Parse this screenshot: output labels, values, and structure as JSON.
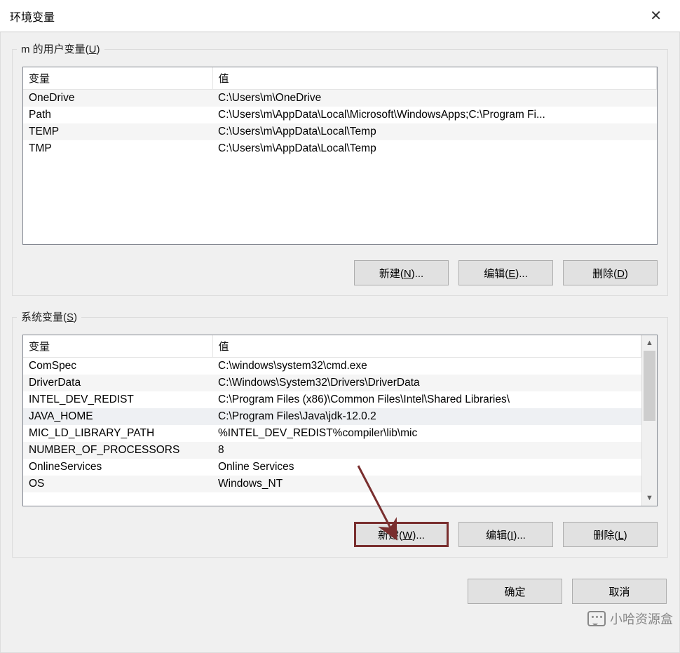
{
  "window": {
    "title": "环境变量"
  },
  "user_vars": {
    "group_label": "m 的用户变量(U)",
    "header_var": "变量",
    "header_val": "值",
    "rows": [
      {
        "name": "OneDrive",
        "value": "C:\\Users\\m\\OneDrive"
      },
      {
        "name": "Path",
        "value": "C:\\Users\\m\\AppData\\Local\\Microsoft\\WindowsApps;C:\\Program Fi..."
      },
      {
        "name": "TEMP",
        "value": "C:\\Users\\m\\AppData\\Local\\Temp"
      },
      {
        "name": "TMP",
        "value": "C:\\Users\\m\\AppData\\Local\\Temp"
      }
    ],
    "btn_new": "新建(N)...",
    "btn_edit": "编辑(E)...",
    "btn_delete": "删除(D)"
  },
  "sys_vars": {
    "group_label": "系统变量(S)",
    "header_var": "变量",
    "header_val": "值",
    "rows": [
      {
        "name": "ComSpec",
        "value": "C:\\windows\\system32\\cmd.exe"
      },
      {
        "name": "DriverData",
        "value": "C:\\Windows\\System32\\Drivers\\DriverData"
      },
      {
        "name": "INTEL_DEV_REDIST",
        "value": "C:\\Program Files (x86)\\Common Files\\Intel\\Shared Libraries\\"
      },
      {
        "name": "JAVA_HOME",
        "value": "C:\\Program Files\\Java\\jdk-12.0.2"
      },
      {
        "name": "MIC_LD_LIBRARY_PATH",
        "value": "%INTEL_DEV_REDIST%compiler\\lib\\mic"
      },
      {
        "name": "NUMBER_OF_PROCESSORS",
        "value": "8"
      },
      {
        "name": "OnlineServices",
        "value": "Online Services"
      },
      {
        "name": "OS",
        "value": "Windows_NT"
      }
    ],
    "selected_index": 3,
    "btn_new": "新建(W)...",
    "btn_edit": "编辑(I)...",
    "btn_delete": "删除(L)"
  },
  "dialog": {
    "btn_ok": "确定",
    "btn_cancel": "取消"
  },
  "watermark": {
    "text": "小哈资源盒"
  },
  "annotation": {
    "color": "#792e2e"
  }
}
